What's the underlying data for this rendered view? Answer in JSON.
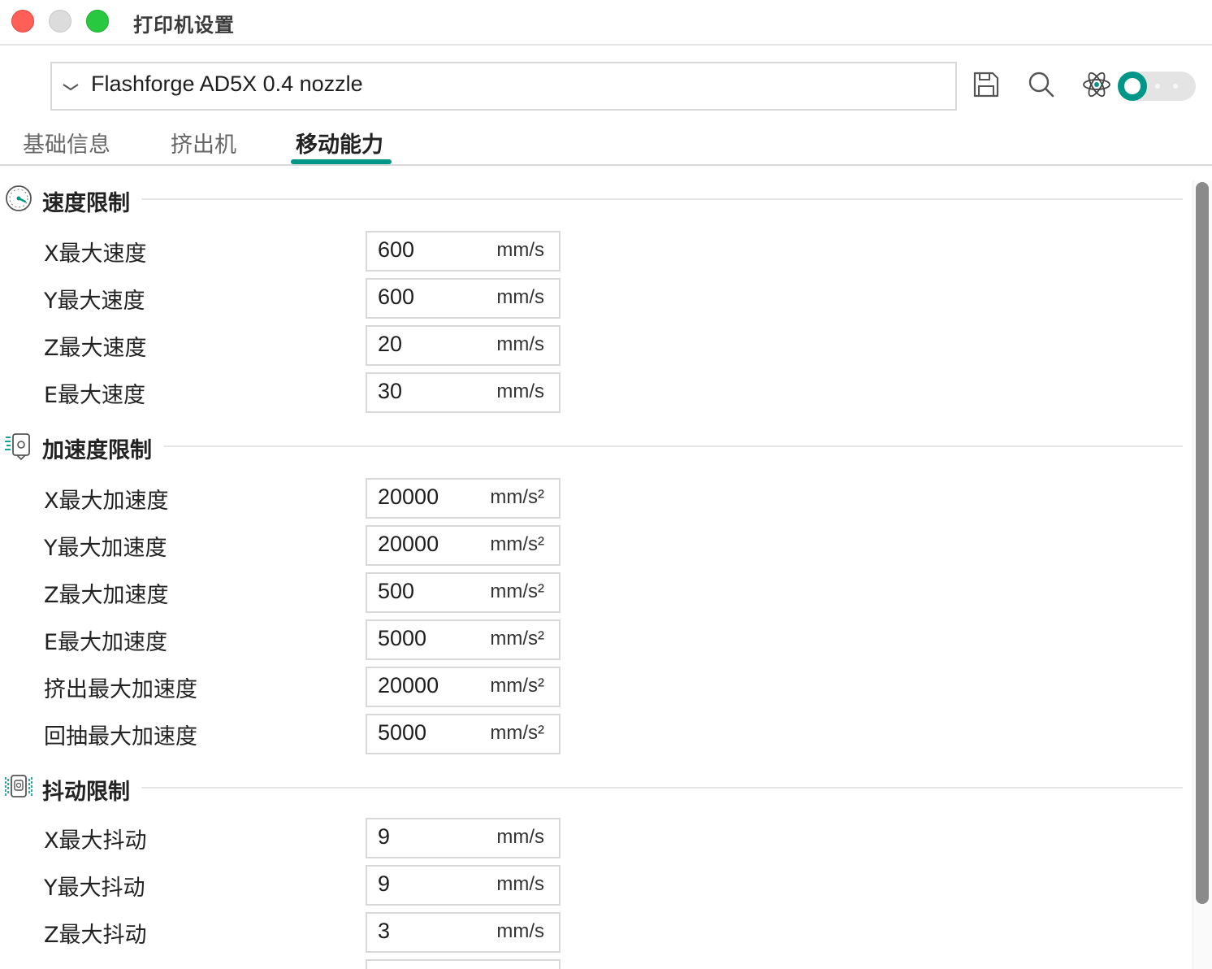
{
  "window": {
    "title": "打印机设置"
  },
  "preset": {
    "name": "Flashforge AD5X 0.4 nozzle"
  },
  "toolbar": {
    "toggle_on": true
  },
  "tabs": [
    {
      "label": "基础信息",
      "active": false
    },
    {
      "label": "挤出机",
      "active": false
    },
    {
      "label": "移动能力",
      "active": true
    }
  ],
  "sections": [
    {
      "title": "速度限制",
      "icon": "speedometer-icon",
      "rows": [
        {
          "label": "X最大速度",
          "value": "600",
          "unit": "mm/s"
        },
        {
          "label": "Y最大速度",
          "value": "600",
          "unit": "mm/s"
        },
        {
          "label": "Z最大速度",
          "value": "20",
          "unit": "mm/s"
        },
        {
          "label": "E最大速度",
          "value": "30",
          "unit": "mm/s"
        }
      ]
    },
    {
      "title": "加速度限制",
      "icon": "acceleration-icon",
      "rows": [
        {
          "label": "X最大加速度",
          "value": "20000",
          "unit": "mm/s²"
        },
        {
          "label": "Y最大加速度",
          "value": "20000",
          "unit": "mm/s²"
        },
        {
          "label": "Z最大加速度",
          "value": "500",
          "unit": "mm/s²"
        },
        {
          "label": "E最大加速度",
          "value": "5000",
          "unit": "mm/s²"
        },
        {
          "label": "挤出最大加速度",
          "value": "20000",
          "unit": "mm/s²"
        },
        {
          "label": "回抽最大加速度",
          "value": "5000",
          "unit": "mm/s²"
        }
      ]
    },
    {
      "title": "抖动限制",
      "icon": "jerk-icon",
      "rows": [
        {
          "label": "X最大抖动",
          "value": "9",
          "unit": "mm/s"
        },
        {
          "label": "Y最大抖动",
          "value": "9",
          "unit": "mm/s"
        },
        {
          "label": "Z最大抖动",
          "value": "3",
          "unit": "mm/s"
        },
        {
          "label": "",
          "value": "",
          "unit": ""
        }
      ]
    }
  ],
  "colors": {
    "accent": "#009688",
    "border": "#d8d8d8",
    "scrollbar": "#8a8a8a"
  }
}
